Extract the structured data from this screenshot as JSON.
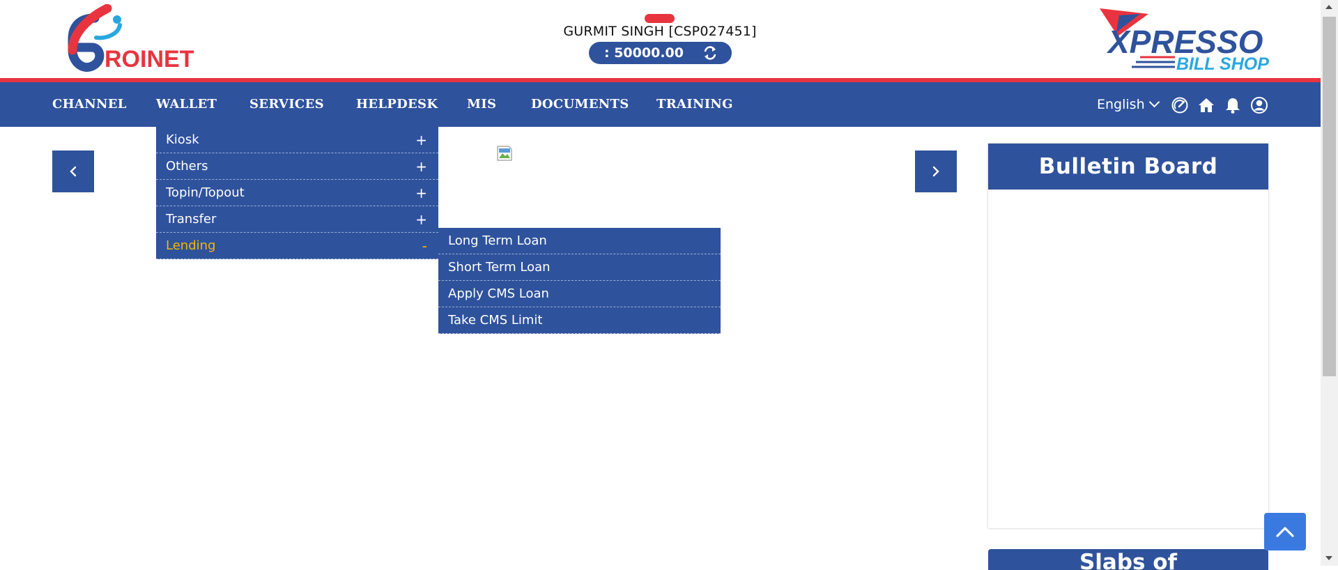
{
  "header": {
    "logo_left_text": "ROINET",
    "user_name": "GURMIT SINGH [CSP027451]",
    "balance": ": 50000.00",
    "logo_right_top": "XPRESSO",
    "logo_right_bottom": "BILL SHOP"
  },
  "nav": {
    "items": [
      {
        "label": "CHANNEL"
      },
      {
        "label": "WALLET"
      },
      {
        "label": "SERVICES"
      },
      {
        "label": "HELPDESK"
      },
      {
        "label": "MIS"
      },
      {
        "label": "DOCUMENTS"
      },
      {
        "label": "TRAINING"
      }
    ],
    "language": "English",
    "icons": [
      "dashboard-icon",
      "home-icon",
      "bell-icon",
      "user-icon"
    ]
  },
  "wallet_menu": {
    "items": [
      {
        "label": "Kiosk",
        "sign": "+"
      },
      {
        "label": "Others",
        "sign": "+"
      },
      {
        "label": "Topin/Topout",
        "sign": "+"
      },
      {
        "label": "Transfer",
        "sign": "+"
      },
      {
        "label": "Lending",
        "sign": "-"
      }
    ],
    "active_item": "Lending"
  },
  "lending_submenu": {
    "items": [
      {
        "label": "Long Term Loan"
      },
      {
        "label": "Short Term Loan"
      },
      {
        "label": "Apply CMS Loan"
      },
      {
        "label": "Take CMS Limit"
      }
    ]
  },
  "bulletin": {
    "title": "Bulletin Board"
  },
  "second_panel": {
    "title": "Slabs of"
  },
  "colors": {
    "primary": "#2f529c",
    "accent_red": "#e8343f",
    "active_text": "#f5b800",
    "scroll_top": "#3a7ae0"
  }
}
